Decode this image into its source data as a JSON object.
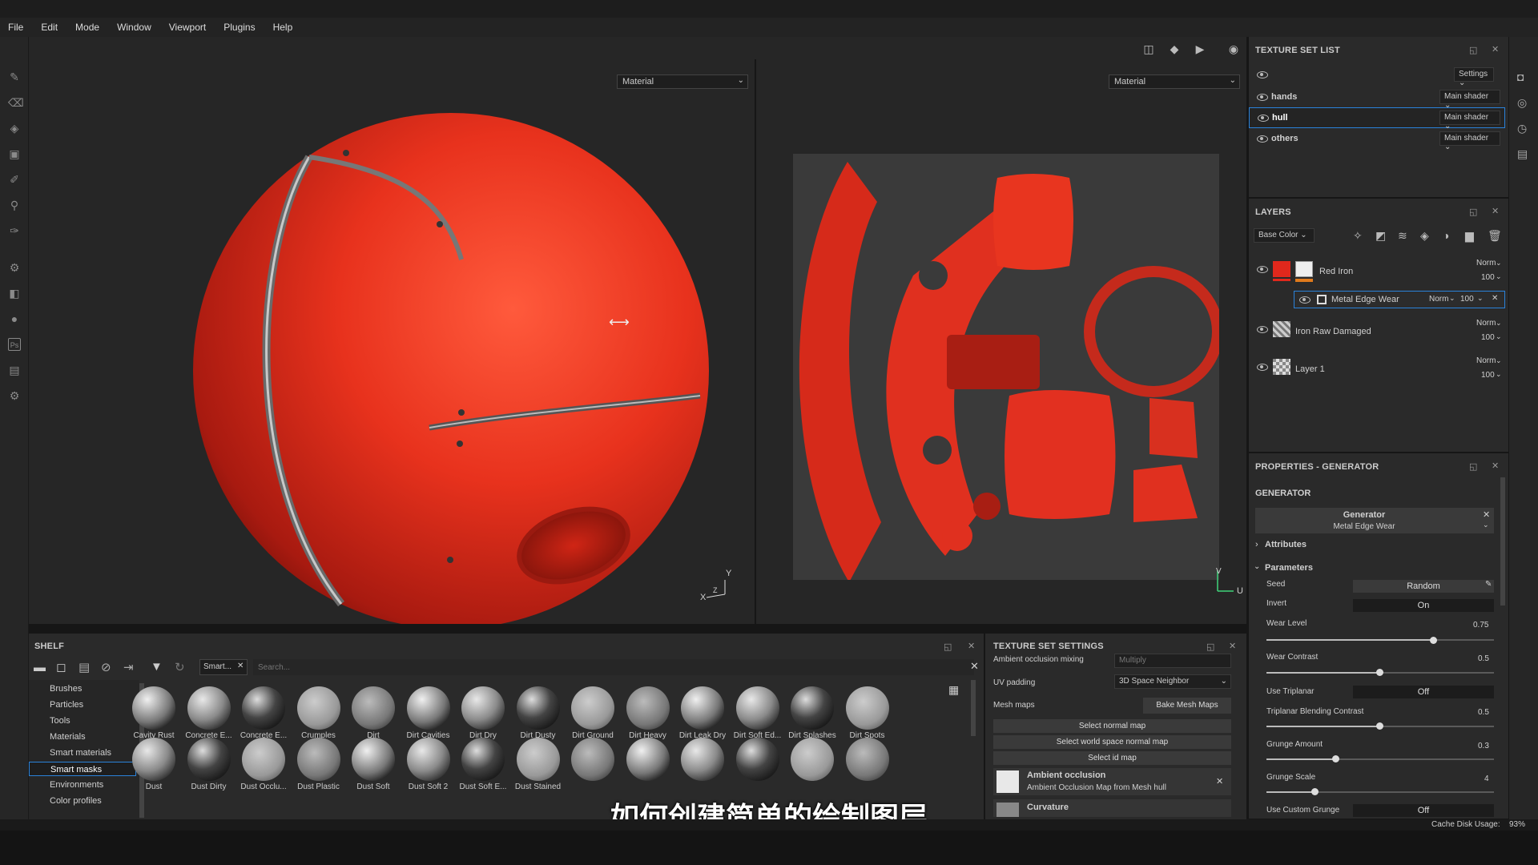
{
  "menu": [
    "File",
    "Edit",
    "Mode",
    "Window",
    "Viewport",
    "Plugins",
    "Help"
  ],
  "viewport": {
    "left_select": "Material",
    "right_select": "Material",
    "axis_3d": {
      "y": "Y",
      "x": "X",
      "z": "Z"
    },
    "axis_2d": {
      "v": "V",
      "u": "U"
    }
  },
  "texture_set_list": {
    "title": "TEXTURE SET LIST",
    "settings": "Settings",
    "sets": [
      {
        "name": "hands",
        "shader": "Main shader"
      },
      {
        "name": "hull",
        "shader": "Main shader",
        "selected": true
      },
      {
        "name": "others",
        "shader": "Main shader"
      }
    ]
  },
  "layers": {
    "title": "LAYERS",
    "channel": "Base Color",
    "items": [
      {
        "name": "Red Iron",
        "blend": "Norm",
        "opacity": "100"
      },
      {
        "name": "Metal Edge Wear",
        "blend": "Norm",
        "opacity": "100",
        "is_mask": true
      },
      {
        "name": "Iron Raw Damaged",
        "blend": "Norm",
        "opacity": "100"
      },
      {
        "name": "Layer 1",
        "blend": "Norm",
        "opacity": "100"
      }
    ]
  },
  "properties": {
    "title": "PROPERTIES - GENERATOR",
    "section": "GENERATOR",
    "generator_name": "Generator",
    "generator_value": "Metal Edge Wear",
    "attributes": "Attributes",
    "parameters": "Parameters",
    "seed_label": "Seed",
    "seed_value": "Random",
    "invert_label": "Invert",
    "invert_value": "On",
    "wear_level_label": "Wear Level",
    "wear_level": "0.75",
    "wear_contrast_label": "Wear Contrast",
    "wear_contrast": "0.5",
    "use_triplanar_label": "Use Triplanar",
    "use_triplanar": "Off",
    "triplanar_blend_label": "Triplanar Blending Contrast",
    "triplanar_blend": "0.5",
    "grunge_amount_label": "Grunge Amount",
    "grunge_amount": "0.3",
    "grunge_scale_label": "Grunge Scale",
    "grunge_scale": "4",
    "custom_grunge_label": "Use Custom Grunge",
    "custom_grunge": "Off"
  },
  "shelf": {
    "title": "SHELF",
    "filter_tag": "Smart...",
    "search_placeholder": "Search...",
    "categories": [
      "Brushes",
      "Particles",
      "Tools",
      "Materials",
      "Smart materials",
      "Smart masks",
      "Environments",
      "Color profiles"
    ],
    "selected_category": "Smart masks",
    "row1": [
      "Cavity Rust",
      "Concrete E...",
      "Concrete E...",
      "Crumples",
      "Dirt",
      "Dirt Cavities",
      "Dirt Dry",
      "Dirt Dusty",
      "Dirt Ground",
      "Dirt Heavy",
      "Dirt Leak Dry",
      "Dirt Soft Ed...",
      "Dirt Splashes",
      "Dirt Spots"
    ],
    "row2": [
      "Dust",
      "Dust Dirty",
      "Dust Occlu...",
      "Dust Plastic",
      "Dust Soft",
      "Dust Soft 2",
      "Dust Soft E...",
      "Dust Stained",
      "",
      "",
      "",
      "",
      "",
      ""
    ]
  },
  "texture_set_settings": {
    "title": "TEXTURE SET SETTINGS",
    "ao_mixing_label": "Ambient occlusion mixing",
    "ao_mixing_value": "Multiply",
    "uv_padding_label": "UV padding",
    "uv_padding_value": "3D Space Neighbor",
    "mesh_maps_label": "Mesh maps",
    "bake_button": "Bake Mesh Maps",
    "select_normal": "Select normal map",
    "select_ws_normal": "Select world space normal map",
    "select_id": "Select id map",
    "ao_title": "Ambient occlusion",
    "ao_desc": "Ambient Occlusion Map from Mesh hull",
    "curvature": "Curvature"
  },
  "subtitle": "如何创建简单的绘制图层",
  "status": {
    "cache": "Cache Disk Usage:",
    "cache_value": "93%"
  },
  "colors": {
    "accent": "#2a82da",
    "red": "#e0281c"
  }
}
